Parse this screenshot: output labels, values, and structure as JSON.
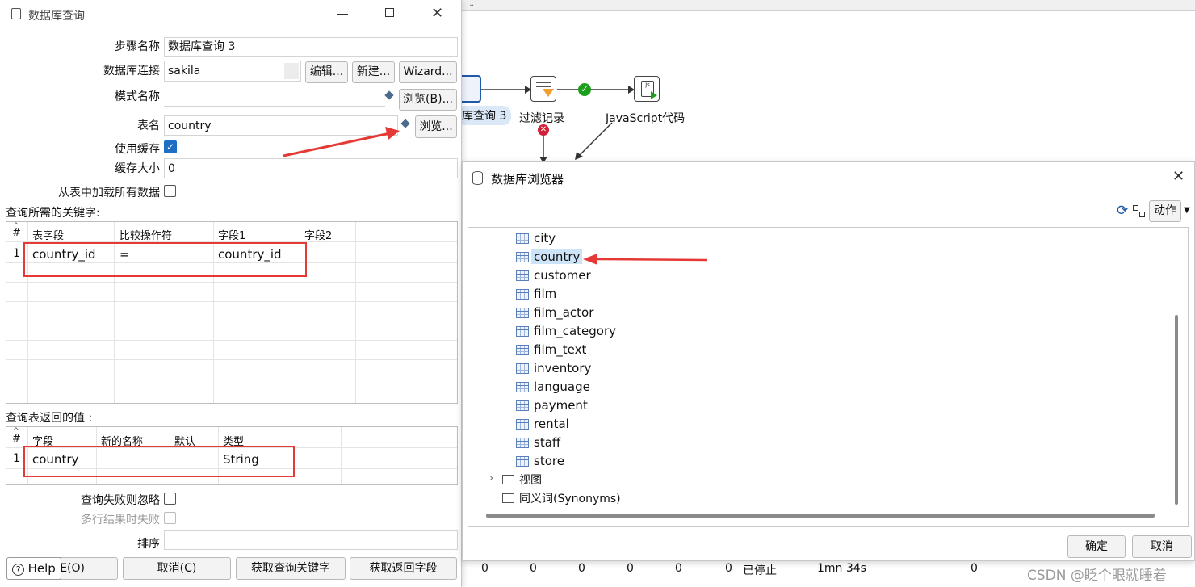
{
  "query_dialog": {
    "title": "数据库查询",
    "step_name_label": "步骤名称",
    "step_name_value": "数据库查询 3",
    "db_conn_label": "数据库连接",
    "db_conn_value": "sakila",
    "edit_btn": "编辑...",
    "new_btn": "新建...",
    "wizard_btn": "Wizard...",
    "schema_label": "模式名称",
    "schema_value": "",
    "browse_b_btn": "浏览(B)...",
    "table_label": "表名",
    "table_value": "country",
    "browse_btn": "浏览...",
    "use_cache_label": "使用缓存",
    "use_cache_checked": true,
    "cache_size_label": "缓存大小",
    "cache_size_value": "0",
    "load_all_label": "从表中加载所有数据",
    "keys_section_label": "查询所需的关键字:",
    "keys_headers": [
      "#",
      "表字段",
      "比较操作符",
      "字段1",
      "字段2"
    ],
    "keys_rows": [
      [
        "1",
        "country_id",
        "=",
        "country_id",
        ""
      ]
    ],
    "return_section_label": "查询表返回的值 :",
    "return_headers": [
      "#",
      "字段",
      "新的名称",
      "默认",
      "类型"
    ],
    "return_rows": [
      [
        "1",
        "country",
        "",
        "",
        "String"
      ]
    ],
    "fail_ignore_label": "查询失败则忽略",
    "multi_fail_label": "多行结果时失败",
    "order_label": "排序",
    "order_value": "",
    "help_btn": "Help",
    "ok_btn_fragment": "E(O)",
    "cancel_btn": "取消(C)",
    "get_keys_btn": "获取查询关键字",
    "get_fields_btn": "获取返回字段"
  },
  "canvas": {
    "node1_label": "库查询 3",
    "node2_label": "过滤记录",
    "node3_label": "JavaScript代码"
  },
  "browser_dialog": {
    "title": "数据库浏览器",
    "action_btn": "动作",
    "tables": [
      "city",
      "country",
      "customer",
      "film",
      "film_actor",
      "film_category",
      "film_text",
      "inventory",
      "language",
      "payment",
      "rental",
      "staff",
      "store"
    ],
    "selected_table": "country",
    "folders": [
      "视图",
      "同义词(Synonyms)"
    ],
    "ok_btn": "确定",
    "cancel_btn": "取消"
  },
  "background_rows": [
    [
      "0",
      "0",
      "0",
      "0",
      "0",
      "0",
      "已停止",
      "1mn 34s",
      "0"
    ]
  ],
  "watermark": "CSDN @眨个眼就睡着"
}
